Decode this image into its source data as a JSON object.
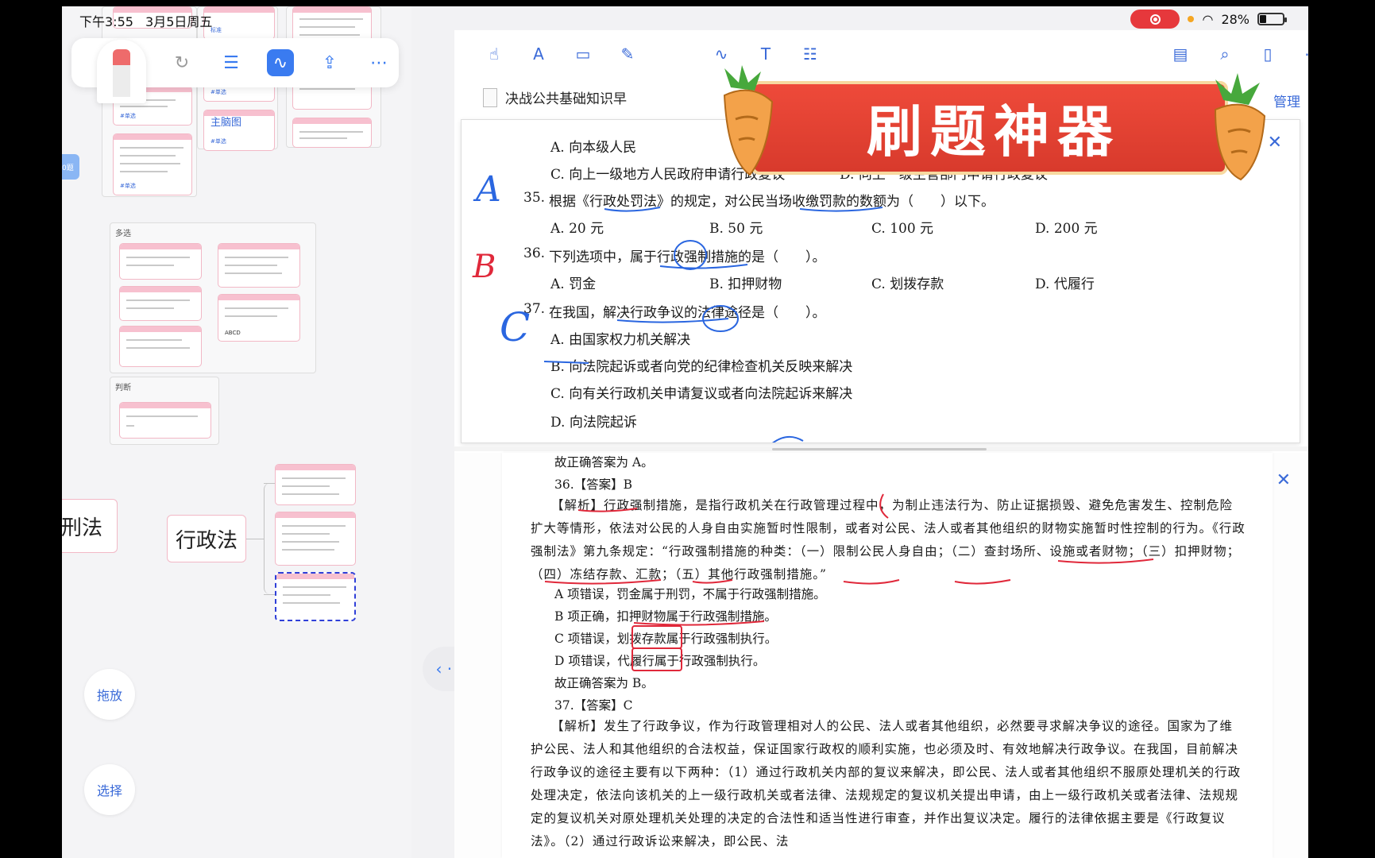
{
  "status_bar": {
    "time": "下午3:55",
    "date": "3月5日周五",
    "battery": "28%"
  },
  "left_pane": {
    "toolbar": {
      "icons": [
        "redo-icon",
        "list-icon",
        "curve-icon",
        "share-icon",
        "more-icon"
      ]
    },
    "groups": [
      {
        "label": "多选"
      },
      {
        "label": "判断"
      }
    ],
    "top_labels": {
      "small_a": "标准",
      "mindmap": "主脑图",
      "single": "#单选"
    },
    "card_small_text": "ABCD",
    "left_edge_node": "刑法",
    "main_node": "行政法",
    "edge_tab": "0题",
    "drag_button": "拖放",
    "select_button": "选择"
  },
  "doc": {
    "file_name": "决战公共基础知识早",
    "manage": "管理",
    "banner_title": "刷题神器",
    "questions": {
      "q34_opt_a": "A. 向本级人民",
      "q34_opt_c": "C. 向上一级地方人民政府申请行政复议",
      "q34_opt_d": "D. 向上一级主管部门申请行政复议",
      "q35_no": "35.",
      "q35_text": "根据《行政处罚法》的规定，对公民当场收缴罚款的数额为（　　）以下。",
      "q35_options": [
        "A. 20 元",
        "B. 50 元",
        "C. 100 元",
        "D. 200 元"
      ],
      "q36_no": "36.",
      "q36_text": "下列选项中，属于行政强制措施的是（　　）。",
      "q36_options": [
        "A. 罚金",
        "B. 扣押财物",
        "C. 划拨存款",
        "D. 代履行"
      ],
      "q37_no": "37.",
      "q37_text": "在我国，解决行政争议的法律途径是（　　）。",
      "q37_options": [
        "A. 由国家权力机关解决",
        "B. 向法院起诉或者向党的纪律检查机关反映来解决",
        "C. 向有关行政机关申请复议或者向法院起诉来解决",
        "D. 向法院起诉"
      ]
    },
    "handwriting": {
      "q35": "A",
      "q36": "B",
      "q37": "C"
    },
    "answers": [
      "故正确答案为 A。",
      "36.【答案】B",
      "【解析】行政强制措施，是指行政机关在行政管理过程中，为制止违法行为、防止证据损毁、避免危害发生、控制危险扩大等情形，依法对公民的人身自由实施暂时性限制，或者对公民、法人或者其他组织的财物实施暂时性控制的行为。《行政强制法》第九条规定：“行政强制措施的种类：（一）限制公民人身自由；（二）查封场所、设施或者财物；（三）扣押财物；（四）冻结存款、汇款；（五）其他行政强制措施。”",
      "A 项错误，罚金属于刑罚，不属于行政强制措施。",
      "B 项正确，扣押财物属于行政强制措施。",
      "C 项错误，划拨存款属于行政强制执行。",
      "D 项错误，代履行属于行政强制执行。",
      "故正确答案为 B。",
      "37.【答案】C",
      "【解析】发生了行政争议，作为行政管理相对人的公民、法人或者其他组织，必然要寻求解决争议的途径。国家为了维护公民、法人和其他组织的合法权益，保证国家行政权的顺利实施，也必须及时、有效地解决行政争议。在我国，目前解决行政争议的途径主要有以下两种：（1）通过行政机关内部的复议来解决，即公民、法人或者其他组织不服原处理机关的行政处理决定，依法向该机关的上一级行政机关或者法律、法规规定的复议机关提出申请，由上一级行政机关或者法律、法规规定的复议机关对原处理机关处理的决定的合法性和适当性进行审查，并作出复议决定。履行的法律依据主要是《行政复议法》。（2）通过行政诉讼来解决，即公民、法"
    ]
  },
  "colors": {
    "accent": "#3a6ad8",
    "annotation_red": "#e0283a",
    "annotation_blue": "#2a66e0",
    "banner": "#e04535"
  }
}
